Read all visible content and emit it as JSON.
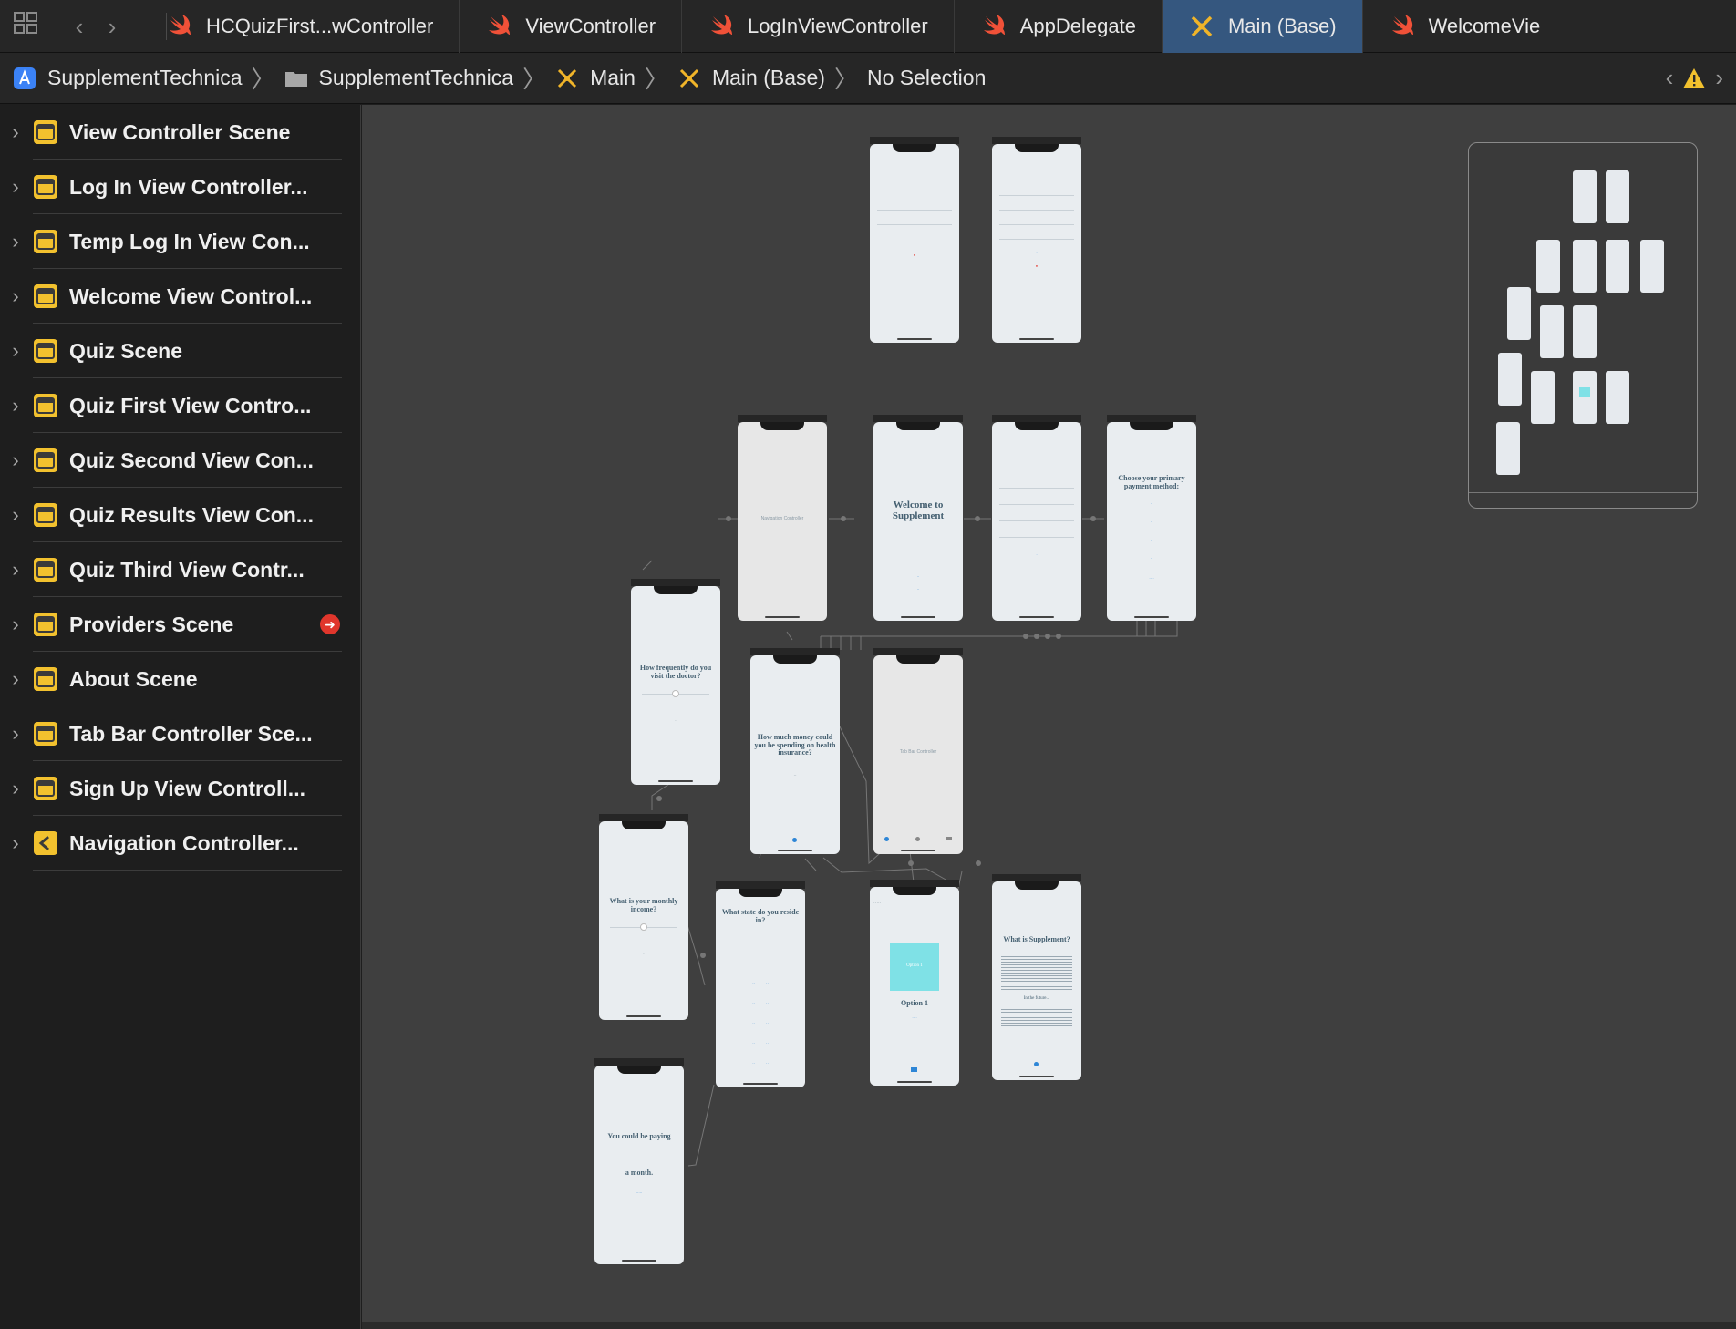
{
  "tabs": [
    {
      "label": "HCQuizFirst...wController",
      "icon": "swift-icon",
      "active": false
    },
    {
      "label": "ViewController",
      "icon": "swift-icon",
      "active": false
    },
    {
      "label": "LogInViewController",
      "icon": "swift-icon",
      "active": false
    },
    {
      "label": "AppDelegate",
      "icon": "swift-icon",
      "active": false
    },
    {
      "label": "Main (Base)",
      "icon": "interface-builder-icon",
      "active": true
    },
    {
      "label": "WelcomeVie",
      "icon": "swift-icon",
      "active": false
    }
  ],
  "jumpbar": {
    "project": "SupplementTechnica",
    "group": "SupplementTechnica",
    "file": "Main",
    "localization": "Main (Base)",
    "selection": "No Selection"
  },
  "outline": [
    {
      "label": "View Controller Scene",
      "error": false
    },
    {
      "label": "Log In View Controller...",
      "error": false
    },
    {
      "label": "Temp Log In View Con...",
      "error": false
    },
    {
      "label": "Welcome View Control...",
      "error": false
    },
    {
      "label": "Quiz Scene",
      "error": false
    },
    {
      "label": "Quiz First View Contro...",
      "error": false
    },
    {
      "label": "Quiz Second View Con...",
      "error": false
    },
    {
      "label": "Quiz Results View Con...",
      "error": false
    },
    {
      "label": "Quiz Third View Contr...",
      "error": false
    },
    {
      "label": "Providers Scene",
      "error": true
    },
    {
      "label": "About Scene",
      "error": false
    },
    {
      "label": "Tab Bar Controller Sce...",
      "error": false
    },
    {
      "label": "Sign Up View Controll...",
      "error": false
    },
    {
      "label": "Navigation Controller...",
      "error": false
    }
  ],
  "canvas": {
    "nav_label": "Navigation Controller",
    "welcome_title": "Welcome to Supplement",
    "payment_title": "Choose your primary payment method:",
    "doctor_q": "How frequently do you visit the doctor?",
    "money_q": "How much money could you be spending on health insurance?",
    "tabbar_label": "Tab Bar Controller",
    "income_q": "What is your monthly income?",
    "state_q": "What state do you reside in?",
    "option_label": "Option 1",
    "option_title": "Option 1",
    "about_title": "What is Supplement?",
    "about_future": "In the future...",
    "paying_top": "You could be paying",
    "paying_bottom": "a month."
  }
}
